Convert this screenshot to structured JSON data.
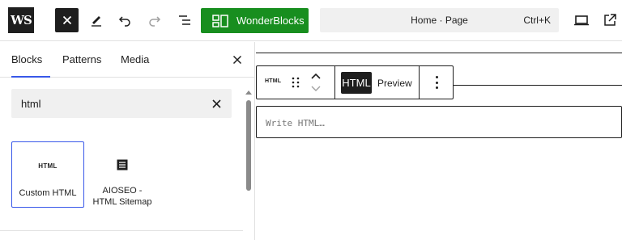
{
  "topbar": {
    "logo_text": "WS",
    "brand_button_label": "WonderBlocks",
    "command": {
      "title": "Home · Page",
      "shortcut": "Ctrl+K"
    },
    "accent_color": "#188e1f"
  },
  "sidebar": {
    "tabs": [
      {
        "label": "Blocks",
        "active": true
      },
      {
        "label": "Patterns",
        "active": false
      },
      {
        "label": "Media",
        "active": false
      }
    ],
    "search": {
      "value": "html"
    },
    "results": [
      {
        "badge": "HTML",
        "label": "Custom HTML",
        "selected": true
      },
      {
        "icon": "sitemap-list-icon",
        "label_line1": "AIOSEO -",
        "label_line2": "HTML Sitemap",
        "selected": false
      }
    ],
    "selection_color": "#3858e9"
  },
  "editor": {
    "toolbar": {
      "block_icon_text": "HTML",
      "mode_html": "HTML",
      "mode_preview": "Preview"
    },
    "placeholder": "Write HTML…"
  }
}
